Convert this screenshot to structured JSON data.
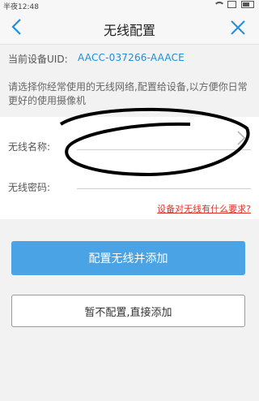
{
  "status_bar": {
    "time": "半夜12:48"
  },
  "header": {
    "title": "无线配置",
    "back_icon": "chevron-left-icon",
    "close_icon": "close-icon"
  },
  "device": {
    "uid_label": "当前设备UID:",
    "uid_value": "AACC-037266-AAACE"
  },
  "tip": "请选择你经常使用的无线网络,配置给设备,以方便你日常更好的使用摄像机",
  "form": {
    "wifi_name_label": "无线名称:",
    "wifi_name_value": "",
    "wifi_password_label": "无线密码:",
    "wifi_password_value": "",
    "help_link": "设备对无线有什么要求?"
  },
  "buttons": {
    "configure_add": "配置无线并添加",
    "skip_add": "暂不配置,直接添加"
  },
  "colors": {
    "accent": "#4aa3e5",
    "uid_blue": "#1d8fd8",
    "link_red": "#d9352b"
  }
}
